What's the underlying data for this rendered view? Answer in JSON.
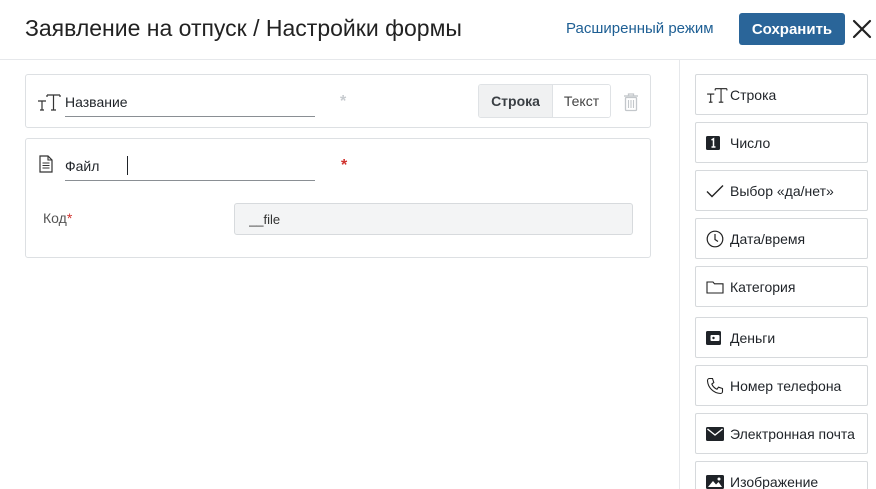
{
  "header": {
    "title": "Заявление на отпуск / Настройки формы",
    "advanced_mode_label": "Расширенный режим",
    "save_label": "Сохранить"
  },
  "form_fields": [
    {
      "icon": "text-format-icon",
      "name": "Название",
      "required_mark": "*",
      "required": false,
      "toggle": {
        "options": [
          "Строка",
          "Текст"
        ],
        "selected": "Строка"
      }
    },
    {
      "icon": "file-icon",
      "name": "Файл",
      "required_mark": "*",
      "required": true,
      "code": {
        "label": "Код",
        "required_mark": "*",
        "value": "__file"
      }
    }
  ],
  "sidebar": {
    "items": [
      {
        "label": "Строка",
        "icon": "text-format-icon"
      },
      {
        "label": "Число",
        "icon": "number-icon"
      },
      {
        "label": "Выбор «да/нет»",
        "icon": "checkmark-icon"
      },
      {
        "label": "Дата/время",
        "icon": "clock-icon"
      },
      {
        "label": "Категория",
        "icon": "folder-icon"
      },
      {
        "label": "Деньги",
        "icon": "wallet-icon"
      },
      {
        "label": "Номер телефона",
        "icon": "phone-icon"
      },
      {
        "label": "Электронная почта",
        "icon": "envelope-icon"
      },
      {
        "label": "Изображение",
        "icon": "image-icon"
      }
    ]
  },
  "colors": {
    "accent": "#2a6599",
    "link": "#1e5f94",
    "required": "#d0312d",
    "border": "#dde0e3"
  }
}
